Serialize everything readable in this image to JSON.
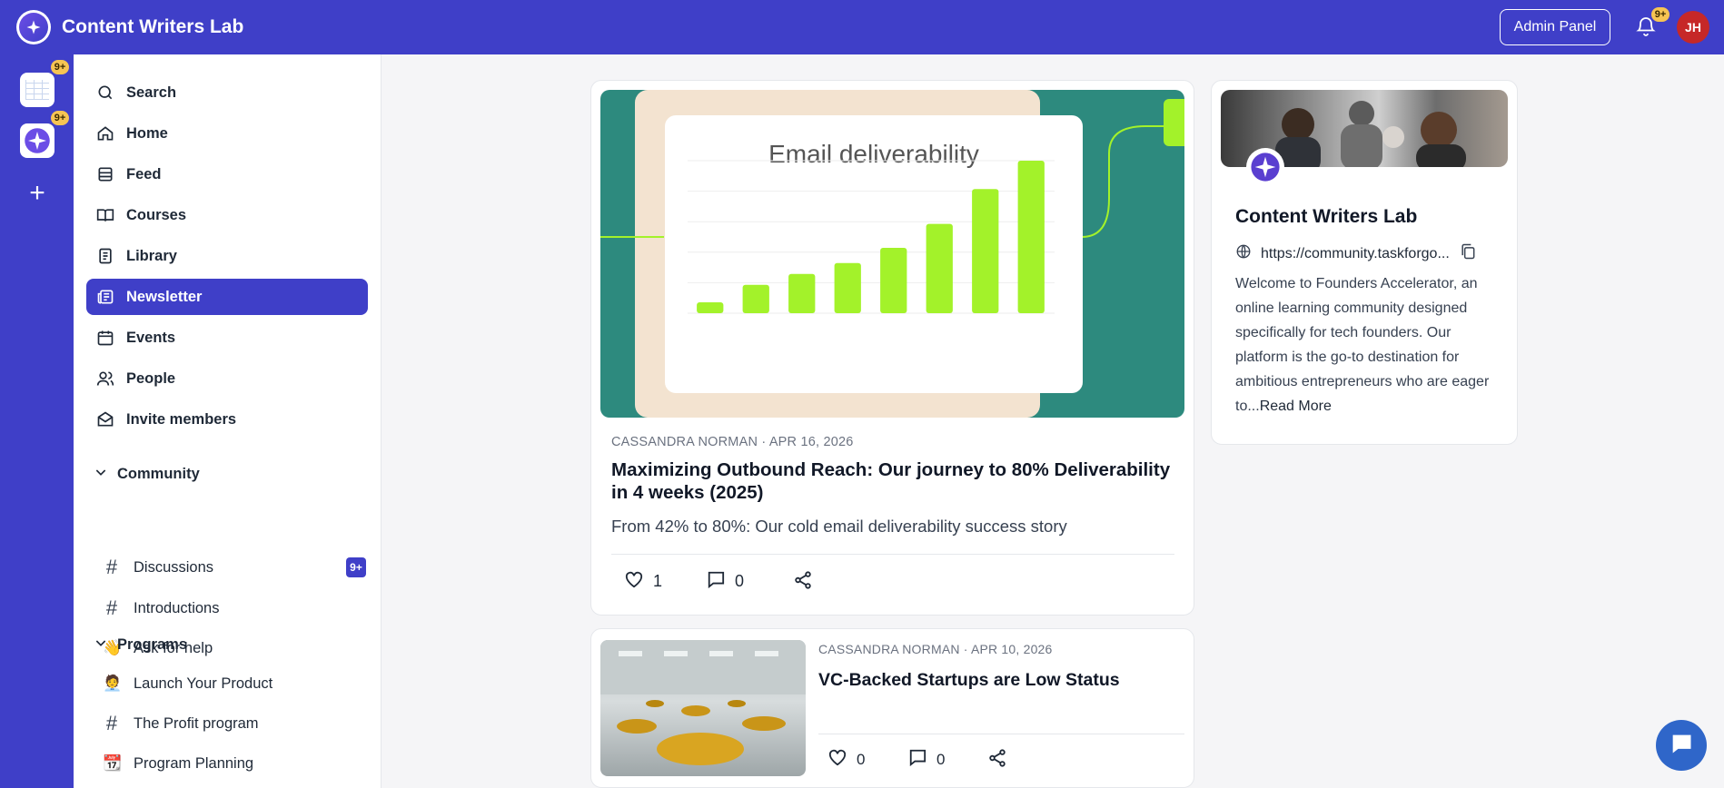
{
  "app": {
    "title": "Content Writers Lab"
  },
  "header": {
    "admin_label": "Admin Panel",
    "notifications_badge": "9+",
    "avatar_initials": "JH"
  },
  "rail": {
    "apps": [
      {
        "name": "spreadsheet-app",
        "badge": "9+"
      },
      {
        "name": "community-app",
        "badge": "9+"
      }
    ],
    "add_label": "+"
  },
  "sidebar": {
    "items": [
      {
        "label": "Search",
        "icon": "search-icon"
      },
      {
        "label": "Home",
        "icon": "home-icon"
      },
      {
        "label": "Feed",
        "icon": "feed-icon"
      },
      {
        "label": "Courses",
        "icon": "book-icon"
      },
      {
        "label": "Library",
        "icon": "library-icon"
      },
      {
        "label": "Newsletter",
        "icon": "newsletter-icon",
        "active": true
      },
      {
        "label": "Events",
        "icon": "calendar-icon"
      },
      {
        "label": "People",
        "icon": "people-icon"
      },
      {
        "label": "Invite members",
        "icon": "envelope-icon"
      }
    ],
    "community": {
      "title": "Community",
      "items": [
        {
          "label": "Discussions",
          "icon": "#",
          "badge": "9+"
        },
        {
          "label": "Introductions",
          "icon": "#"
        },
        {
          "label": "Ask for help",
          "icon": "👋"
        }
      ]
    },
    "programs": {
      "title": "Programs",
      "items": [
        {
          "label": "Launch Your Product",
          "icon": "🧑‍💼"
        },
        {
          "label": "The Profit program",
          "icon": "#"
        },
        {
          "label": "Program Planning",
          "icon": "📆"
        }
      ]
    }
  },
  "posts": [
    {
      "author": "CASSANDRA NORMAN",
      "date": "APR 16, 2026",
      "title": "Maximizing Outbound Reach: Our journey to 80% Deliverability in 4 weeks (2025)",
      "subtitle": "From 42% to 80%: Our cold email deliverability success story",
      "likes": "1",
      "comments": "0",
      "image_caption": "Email deliverability"
    },
    {
      "author": "CASSANDRA NORMAN",
      "date": "APR 10, 2026",
      "title": "VC-Backed Startups are Low Status",
      "likes": "0",
      "comments": "0"
    }
  ],
  "community_card": {
    "title": "Content Writers Lab",
    "url": "https://community.taskforgo...",
    "description": "Welcome to Founders Accelerator, an online learning community designed specifically for tech founders. Our platform is the go-to destination for ambitious entrepreneurs who are eager to...",
    "read_more": "Read More"
  },
  "hero_chart": {
    "bar_values": [
      10,
      26,
      36,
      46,
      60,
      82,
      114,
      140
    ],
    "bar_max": 140
  },
  "colors": {
    "brand": "#3f3fc8",
    "badge": "#f6c453",
    "hero_bg": "#2d8a7e",
    "bar": "#a3f22a"
  }
}
